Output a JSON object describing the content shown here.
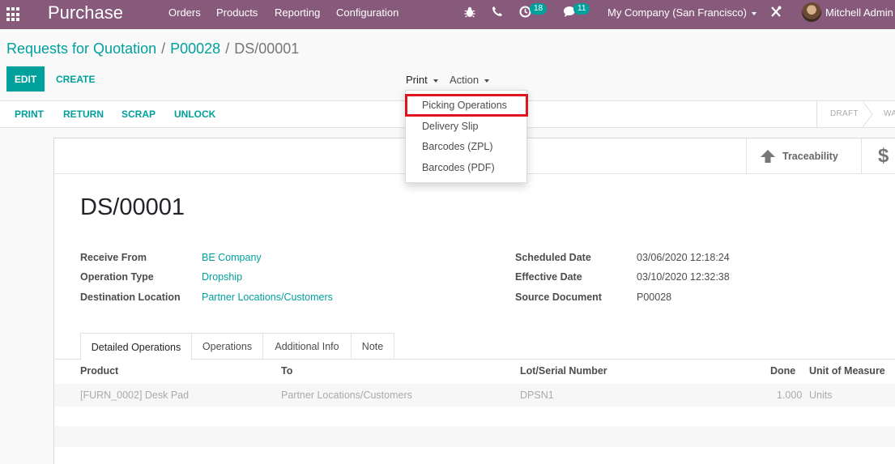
{
  "navbar": {
    "app_name": "Purchase",
    "menu": [
      "Orders",
      "Products",
      "Reporting",
      "Configuration"
    ],
    "activity_badge": "18",
    "messages_badge": "11",
    "company": "My Company (San Francisco)",
    "user": "Mitchell Admin",
    "color": "#875a7b"
  },
  "breadcrumb": {
    "items": [
      "Requests for Quotation",
      "P00028"
    ],
    "current": "DS/00001",
    "separator": "/"
  },
  "control": {
    "edit_label": "EDIT",
    "create_label": "CREATE",
    "print_label": "Print",
    "action_label": "Action"
  },
  "print_menu": {
    "items": [
      "Picking Operations",
      "Delivery Slip",
      "Barcodes (ZPL)",
      "Barcodes (PDF)"
    ],
    "highlighted": "Picking Operations"
  },
  "statusbar": {
    "buttons": [
      "PRINT",
      "RETURN",
      "SCRAP",
      "UNLOCK"
    ],
    "stages": [
      "DRAFT",
      "WA"
    ]
  },
  "smart_buttons": {
    "traceability_label": "Traceability"
  },
  "record": {
    "title": "DS/00001",
    "left_fields": [
      {
        "label": "Receive From",
        "value": "BE Company"
      },
      {
        "label": "Operation Type",
        "value": "Dropship"
      },
      {
        "label": "Destination Location",
        "value": "Partner Locations/Customers"
      }
    ],
    "right_fields": [
      {
        "label": "Scheduled Date",
        "value": "03/06/2020 12:18:24"
      },
      {
        "label": "Effective Date",
        "value": "03/10/2020 12:32:38"
      },
      {
        "label": "Source Document",
        "value": "P00028"
      }
    ]
  },
  "tabs": [
    "Detailed Operations",
    "Operations",
    "Additional Info",
    "Note"
  ],
  "table": {
    "headers": [
      "Product",
      "To",
      "Lot/Serial Number",
      "Done",
      "Unit of Measure"
    ],
    "rows": [
      [
        "[FURN_0002] Desk Pad",
        "Partner Locations/Customers",
        "DPSN1",
        "1.000",
        "Units"
      ]
    ]
  },
  "colors": {
    "primary": "#00a09d",
    "navbar": "#875a7b",
    "highlight": "#e0141e"
  }
}
